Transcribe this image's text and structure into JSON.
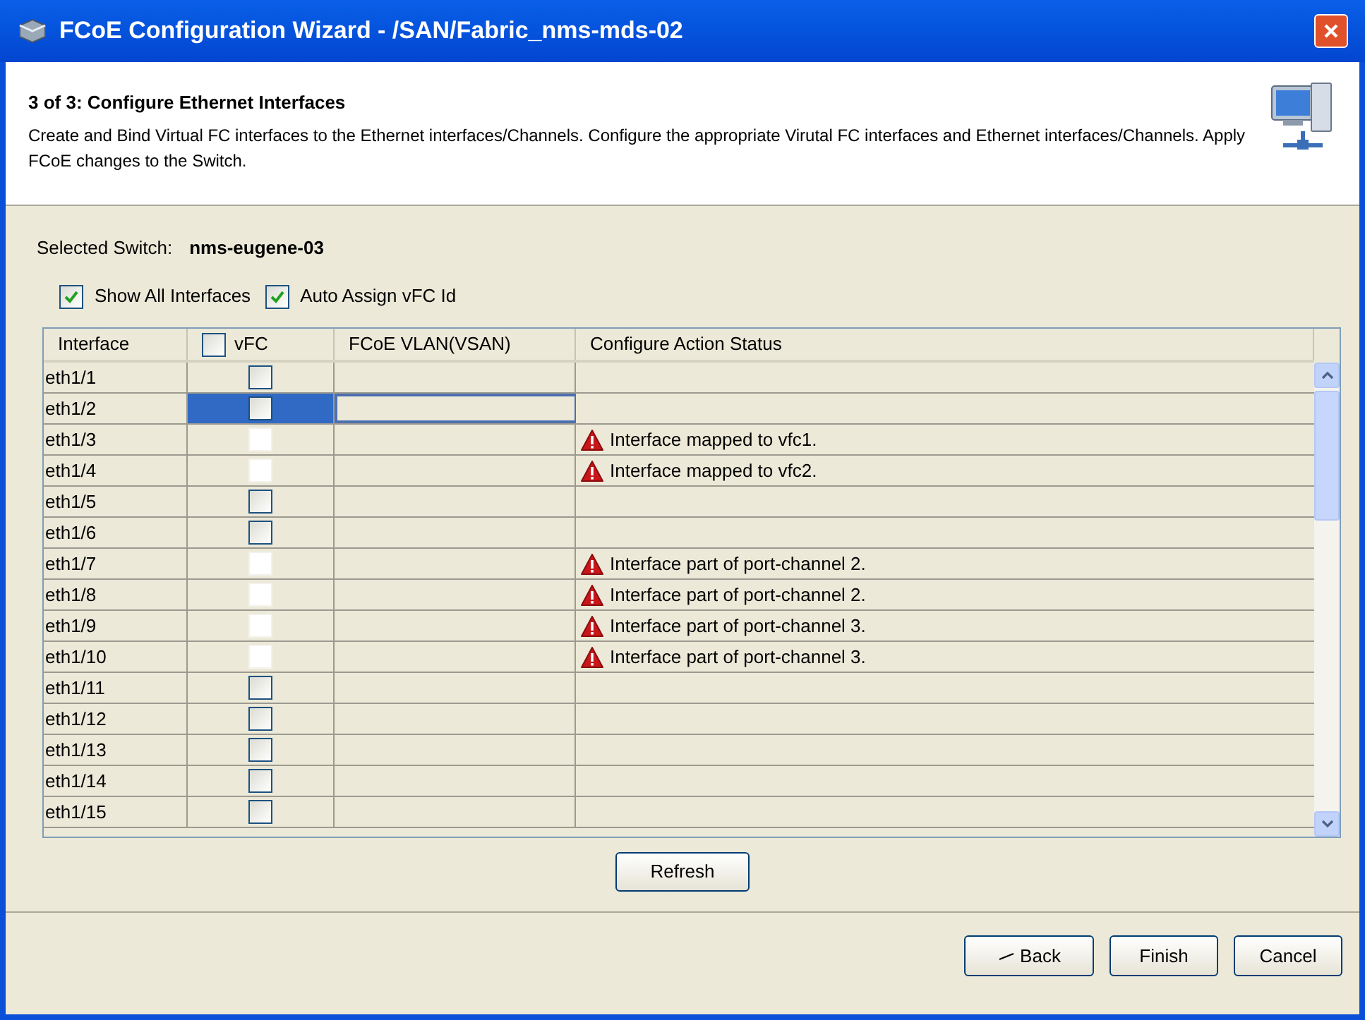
{
  "window": {
    "title": "FCoE Configuration Wizard - /SAN/Fabric_nms-mds-02"
  },
  "header": {
    "step": "3 of 3: Configure Ethernet Interfaces",
    "description": "Create and Bind Virtual FC interfaces to the Ethernet interfaces/Channels. Configure the appropriate Virutal FC interfaces and Ethernet interfaces/Channels. Apply FCoE changes to the Switch."
  },
  "selected_switch": {
    "label": "Selected Switch:",
    "value": "nms-eugene-03"
  },
  "options": [
    {
      "label": "Show All Interfaces",
      "checked": true
    },
    {
      "label": "Auto Assign vFC Id",
      "checked": true
    }
  ],
  "table": {
    "columns": [
      {
        "label": "Interface"
      },
      {
        "label": "vFC",
        "checked": false
      },
      {
        "label": "FCoE VLAN(VSAN)"
      },
      {
        "label": "Configure Action Status"
      }
    ],
    "rows": [
      {
        "interface": "eth1/1",
        "enabled": true,
        "checked": false,
        "selected": false
      },
      {
        "interface": "eth1/2",
        "enabled": true,
        "checked": false,
        "selected": true
      },
      {
        "interface": "eth1/3",
        "enabled": false,
        "checked": false,
        "selected": false,
        "status": "Interface mapped to vfc1."
      },
      {
        "interface": "eth1/4",
        "enabled": false,
        "checked": false,
        "selected": false,
        "status": "Interface mapped to vfc2."
      },
      {
        "interface": "eth1/5",
        "enabled": true,
        "checked": false,
        "selected": false
      },
      {
        "interface": "eth1/6",
        "enabled": true,
        "checked": false,
        "selected": false
      },
      {
        "interface": "eth1/7",
        "enabled": false,
        "checked": false,
        "selected": false,
        "status": "Interface part of port-channel 2."
      },
      {
        "interface": "eth1/8",
        "enabled": false,
        "checked": false,
        "selected": false,
        "status": "Interface part of port-channel 2."
      },
      {
        "interface": "eth1/9",
        "enabled": false,
        "checked": false,
        "selected": false,
        "status": "Interface part of port-channel 3."
      },
      {
        "interface": "eth1/10",
        "enabled": false,
        "checked": false,
        "selected": false,
        "status": "Interface part of port-channel 3."
      },
      {
        "interface": "eth1/11",
        "enabled": true,
        "checked": false,
        "selected": false
      },
      {
        "interface": "eth1/12",
        "enabled": true,
        "checked": false,
        "selected": false
      },
      {
        "interface": "eth1/13",
        "enabled": true,
        "checked": false,
        "selected": false
      },
      {
        "interface": "eth1/14",
        "enabled": true,
        "checked": false,
        "selected": false
      },
      {
        "interface": "eth1/15",
        "enabled": true,
        "checked": false,
        "selected": false
      }
    ]
  },
  "refresh_button": "Refresh",
  "buttons": [
    {
      "label": "Back",
      "kind": "back"
    },
    {
      "label": "Finish",
      "kind": "plain"
    },
    {
      "label": "Cancel",
      "kind": "plain"
    }
  ]
}
